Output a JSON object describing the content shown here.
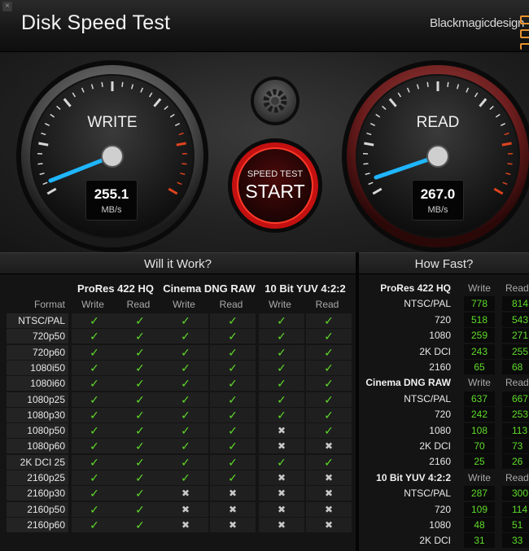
{
  "titlebar": {
    "close": "×",
    "title": "Disk Speed Test",
    "brand": "Blackmagicdesign"
  },
  "gauges": {
    "write": {
      "label": "WRITE",
      "value": "255.1",
      "unit": "MB/s"
    },
    "read": {
      "label": "READ",
      "value": "267.0",
      "unit": "MB/s"
    },
    "start": {
      "small": "SPEED TEST",
      "big": "START"
    }
  },
  "will": {
    "title": "Will it Work?",
    "format_label": "Format",
    "groups": [
      "ProRes 422 HQ",
      "Cinema DNG RAW",
      "10 Bit YUV 4:2:2"
    ],
    "sub": [
      "Write",
      "Read"
    ],
    "rows": [
      {
        "format": "NTSC/PAL",
        "cells": [
          1,
          1,
          1,
          1,
          1,
          1
        ]
      },
      {
        "format": "720p50",
        "cells": [
          1,
          1,
          1,
          1,
          1,
          1
        ]
      },
      {
        "format": "720p60",
        "cells": [
          1,
          1,
          1,
          1,
          1,
          1
        ]
      },
      {
        "format": "1080i50",
        "cells": [
          1,
          1,
          1,
          1,
          1,
          1
        ]
      },
      {
        "format": "1080i60",
        "cells": [
          1,
          1,
          1,
          1,
          1,
          1
        ]
      },
      {
        "format": "1080p25",
        "cells": [
          1,
          1,
          1,
          1,
          1,
          1
        ]
      },
      {
        "format": "1080p30",
        "cells": [
          1,
          1,
          1,
          1,
          1,
          1
        ]
      },
      {
        "format": "1080p50",
        "cells": [
          1,
          1,
          1,
          1,
          0,
          1
        ]
      },
      {
        "format": "1080p60",
        "cells": [
          1,
          1,
          1,
          1,
          0,
          0
        ]
      },
      {
        "format": "2K DCI 25",
        "cells": [
          1,
          1,
          1,
          1,
          1,
          1
        ]
      },
      {
        "format": "2160p25",
        "cells": [
          1,
          1,
          1,
          1,
          0,
          0
        ]
      },
      {
        "format": "2160p30",
        "cells": [
          1,
          1,
          0,
          0,
          0,
          0
        ]
      },
      {
        "format": "2160p50",
        "cells": [
          1,
          1,
          0,
          0,
          0,
          0
        ]
      },
      {
        "format": "2160p60",
        "cells": [
          1,
          1,
          0,
          0,
          0,
          0
        ]
      }
    ],
    "check": "✓",
    "cross": "✖"
  },
  "how": {
    "title": "How Fast?",
    "write_label": "Write",
    "read_label": "Read",
    "groups": [
      {
        "name": "ProRes 422 HQ",
        "rows": [
          {
            "format": "NTSC/PAL",
            "write": "778",
            "read": "814"
          },
          {
            "format": "720",
            "write": "518",
            "read": "543"
          },
          {
            "format": "1080",
            "write": "259",
            "read": "271"
          },
          {
            "format": "2K DCI",
            "write": "243",
            "read": "255"
          },
          {
            "format": "2160",
            "write": "65",
            "read": "68"
          }
        ]
      },
      {
        "name": "Cinema DNG RAW",
        "rows": [
          {
            "format": "NTSC/PAL",
            "write": "637",
            "read": "667"
          },
          {
            "format": "720",
            "write": "242",
            "read": "253"
          },
          {
            "format": "1080",
            "write": "108",
            "read": "113"
          },
          {
            "format": "2K DCI",
            "write": "70",
            "read": "73"
          },
          {
            "format": "2160",
            "write": "25",
            "read": "26"
          }
        ]
      },
      {
        "name": "10 Bit YUV 4:2:2",
        "rows": [
          {
            "format": "NTSC/PAL",
            "write": "287",
            "read": "300"
          },
          {
            "format": "720",
            "write": "109",
            "read": "114"
          },
          {
            "format": "1080",
            "write": "48",
            "read": "51"
          },
          {
            "format": "2K DCI",
            "write": "31",
            "read": "33"
          }
        ]
      }
    ]
  }
}
